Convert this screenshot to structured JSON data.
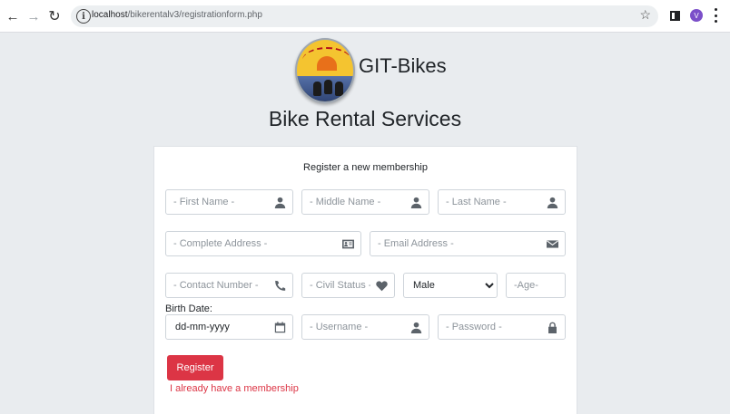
{
  "browser": {
    "url_host": "localhost",
    "url_path": "/bikerentalv3/registrationform.php",
    "avatar_letter": "V"
  },
  "header": {
    "brand": "GIT-Bikes",
    "subtitle": "Bike Rental Services"
  },
  "form": {
    "message": "Register a new membership",
    "first_name": {
      "placeholder": "- First Name -",
      "icon": "user-icon"
    },
    "middle_name": {
      "placeholder": "- Middle Name -",
      "icon": "user-icon"
    },
    "last_name": {
      "placeholder": "- Last Name -",
      "icon": "user-icon"
    },
    "address": {
      "placeholder": "- Complete Address -",
      "icon": "address-card-icon"
    },
    "email": {
      "placeholder": "- Email Address -",
      "icon": "envelope-icon"
    },
    "contact": {
      "placeholder": "- Contact Number -",
      "icon": "phone-icon"
    },
    "civil_status": {
      "placeholder": "- Civil Status -",
      "icon": "heart-icon"
    },
    "gender": {
      "selected": "Male"
    },
    "age": {
      "placeholder": "-Age-"
    },
    "birth_date": {
      "label": "Birth Date:",
      "value": "dd-mm-yyyy",
      "icon": "calendar-icon"
    },
    "username": {
      "placeholder": "- Username -",
      "icon": "user-icon"
    },
    "password": {
      "placeholder": "- Password -",
      "icon": "lock-icon"
    },
    "register_label": "Register",
    "login_link": "I already have a membership"
  },
  "colors": {
    "accent": "#dc3545",
    "background": "#e9ecef"
  }
}
